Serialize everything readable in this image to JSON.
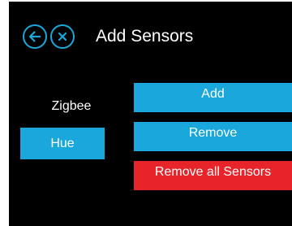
{
  "header": {
    "title": "Add Sensors",
    "back_icon": "arrow-left-circle-icon",
    "close_icon": "close-circle-icon"
  },
  "protocols": {
    "label": "Zigbee",
    "selected": "Hue"
  },
  "actions": {
    "add_label": "Add",
    "remove_label": "Remove",
    "remove_all_label": "Remove all Sensors"
  },
  "colors": {
    "accent": "#1aa8dc",
    "danger": "#e8242b",
    "background": "#000000",
    "text": "#ffffff"
  }
}
